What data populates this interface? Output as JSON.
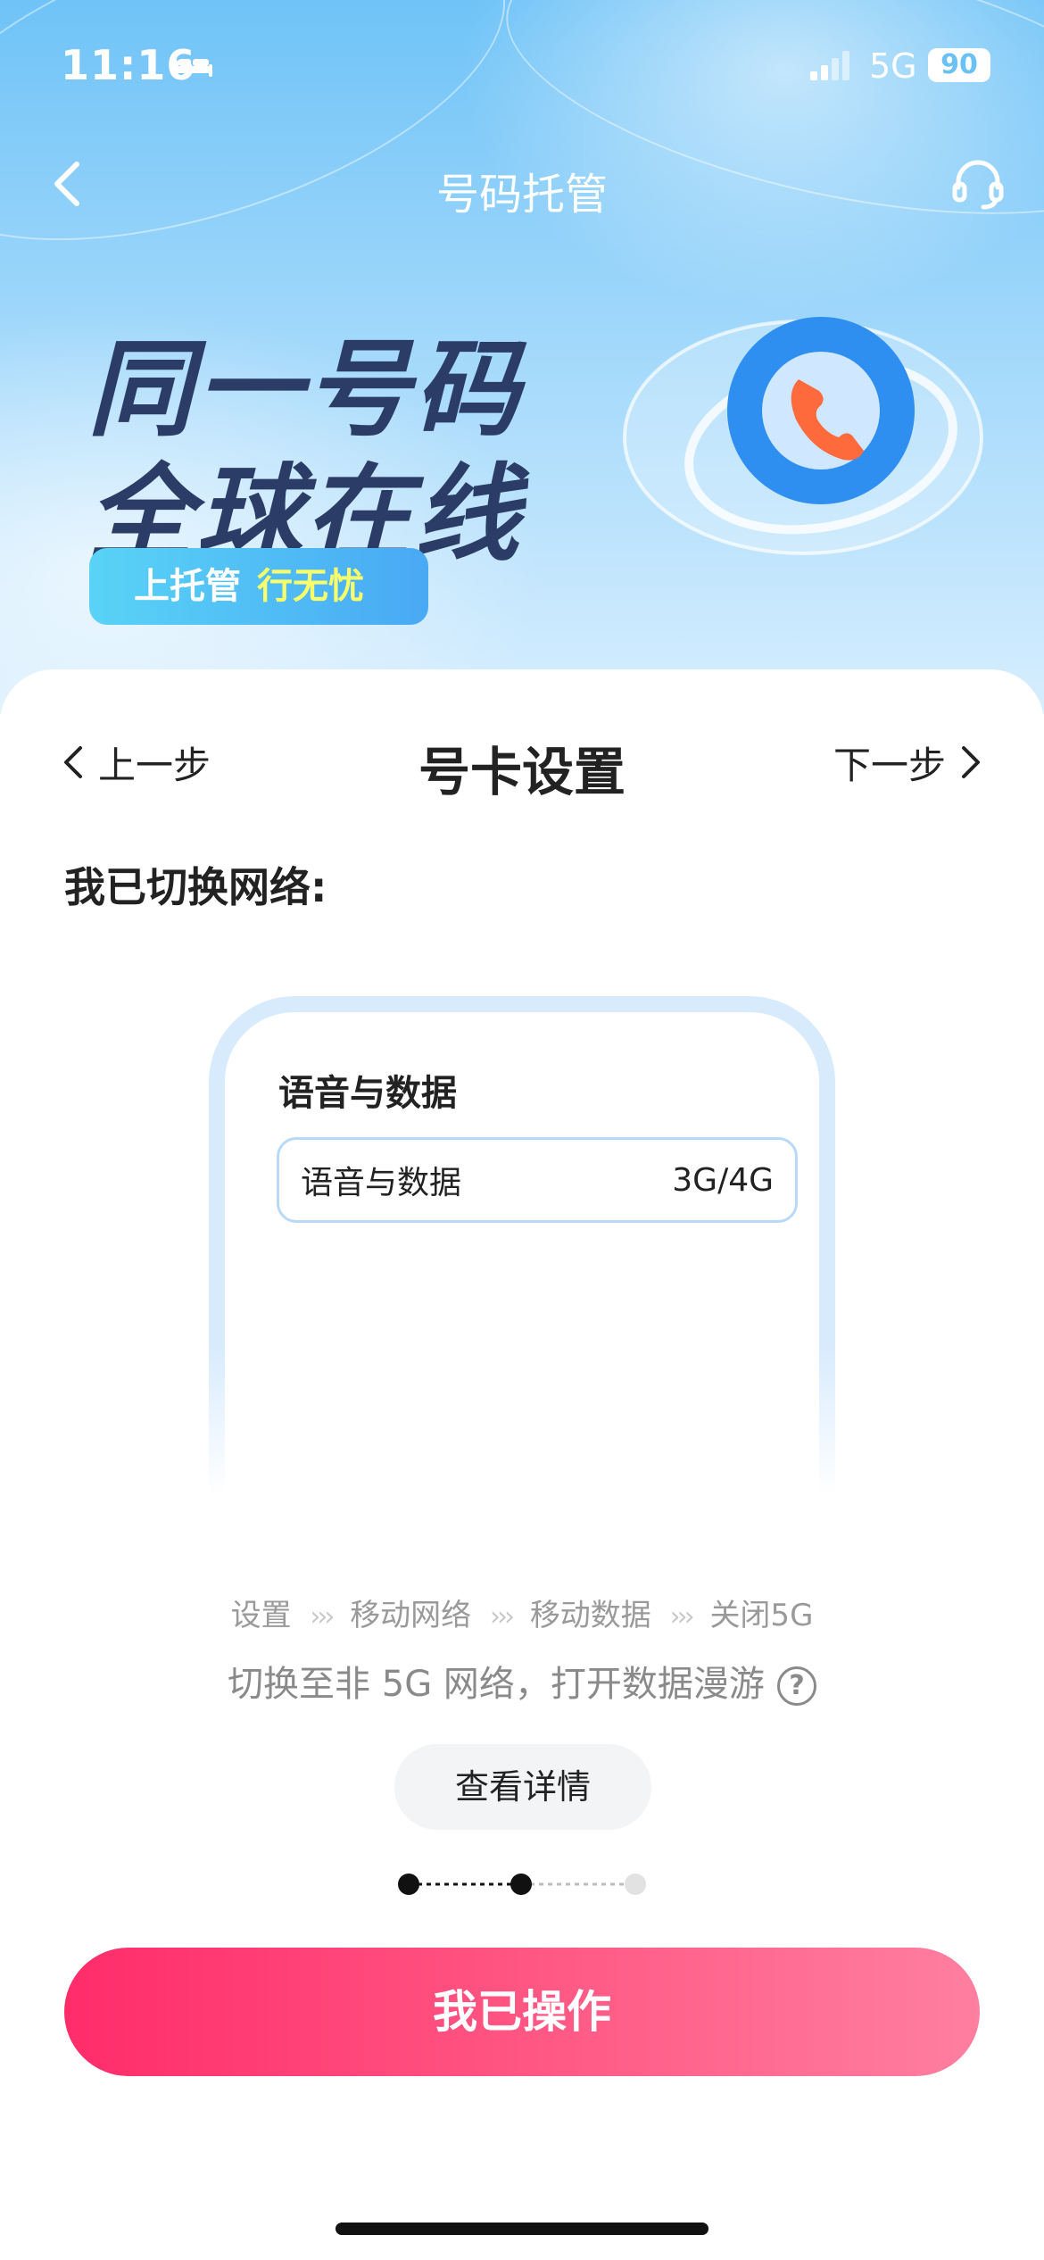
{
  "status_bar": {
    "time": "11:16",
    "network": "5G",
    "battery": "90"
  },
  "nav": {
    "title": "号码托管"
  },
  "hero": {
    "line1": "同一号码",
    "line2": "全球在线",
    "tag_main": "上托管",
    "tag_accent": "行无忧"
  },
  "step": {
    "prev_label": "上一步",
    "title": "号卡设置",
    "next_label": "下一步"
  },
  "section_label": "我已切换网络:",
  "mock": {
    "header": "语音与数据",
    "row_label": "语音与数据",
    "row_value": "3G/4G"
  },
  "breadcrumb": [
    "设置",
    "移动网络",
    "移动数据",
    "关闭5G"
  ],
  "breadcrumb_sep": "›››",
  "instruction": "切换至非 5G 网络，打开数据漫游",
  "help_glyph": "?",
  "detail_button": "查看详情",
  "progress": {
    "total_steps": 3,
    "current_step": 2
  },
  "primary_button": "我已操作",
  "colors": {
    "accent": "#ff2c6a",
    "banner": "#6fc3f7",
    "hero_text": "#2b3d66"
  },
  "icons": [
    "bed-icon",
    "signal-icon",
    "back-icon",
    "headset-icon",
    "chevron-left-icon",
    "chevron-right-icon",
    "help-icon"
  ]
}
